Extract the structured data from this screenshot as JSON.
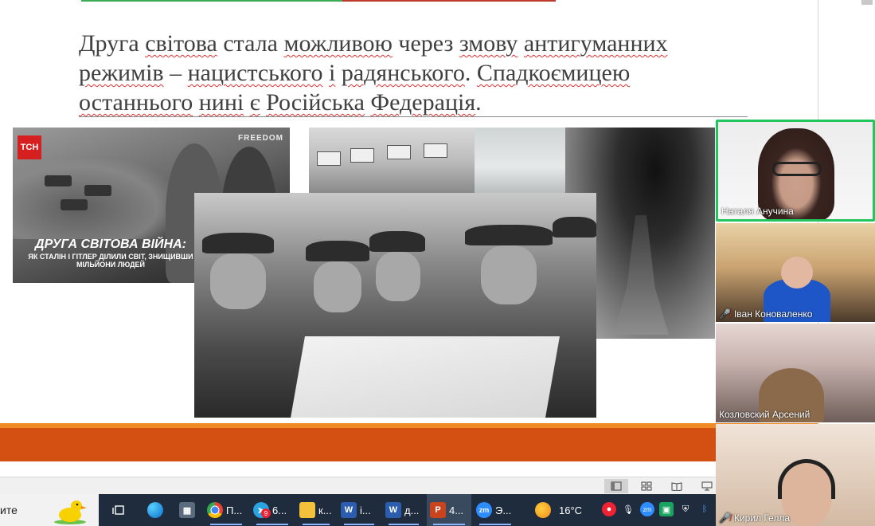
{
  "slide": {
    "text_parts": [
      {
        "t": "Друга ",
        "sq": false
      },
      {
        "t": "світова",
        "sq": true
      },
      {
        "t": " стала ",
        "sq": false
      },
      {
        "t": "можливою",
        "sq": true
      },
      {
        "t": " через ",
        "sq": false
      },
      {
        "t": "змову",
        "sq": true
      },
      {
        "t": " ",
        "sq": false
      },
      {
        "t": "антигуманних",
        "sq": true
      },
      {
        "t": " ",
        "sq": false
      },
      {
        "t": "режимів",
        "sq": true
      },
      {
        "t": " – ",
        "sq": false
      },
      {
        "t": "нацистського",
        "sq": true
      },
      {
        "t": " ",
        "sq": false
      },
      {
        "t": "і",
        "sq": true
      },
      {
        "t": " ",
        "sq": false
      },
      {
        "t": "радянського",
        "sq": true
      },
      {
        "t": ". ",
        "sq": false
      },
      {
        "t": "Спадкоємицею",
        "sq": true
      },
      {
        "t": " ",
        "sq": false
      },
      {
        "t": "останнього",
        "sq": true
      },
      {
        "t": " ",
        "sq": false
      },
      {
        "t": "нині",
        "sq": true
      },
      {
        "t": " ",
        "sq": false
      },
      {
        "t": "є",
        "sq": true
      },
      {
        "t": " ",
        "sq": false
      },
      {
        "t": "Російська",
        "sq": true
      },
      {
        "t": " ",
        "sq": false
      },
      {
        "t": "Федерація",
        "sq": true
      },
      {
        "t": ".",
        "sq": false
      }
    ],
    "tsn_logo": "ТСН",
    "freedom_logo": "FREEDOM",
    "tsn_headline": "ДРУГА СВІТОВА ВІЙНА:",
    "tsn_subline": "ЯК СТАЛІН І ГІТЛЕР ДІЛИЛИ СВІТ, ЗНИЩИВШИ МІЛЬЙОНИ ЛЮДЕЙ"
  },
  "participants": [
    {
      "name": "Наталя Анучина",
      "muted": false,
      "active": true
    },
    {
      "name": "Іван Коноваленко",
      "muted": true,
      "active": false
    },
    {
      "name": "Козловский Арсений",
      "muted": false,
      "active": false
    },
    {
      "name": "Кирил Гелла",
      "muted": true,
      "active": false
    }
  ],
  "taskbar": {
    "search_text": "ите",
    "items": [
      {
        "id": "chrome",
        "label": "П...",
        "color": "#e94235"
      },
      {
        "id": "telegram",
        "label": "6...",
        "color": "#2aa3e0",
        "badge": "9"
      },
      {
        "id": "explorer",
        "label": "к...",
        "color": "#f3c13a"
      },
      {
        "id": "word1",
        "label": "і...",
        "color": "#2b5cad"
      },
      {
        "id": "word2",
        "label": "д...",
        "color": "#2b5cad"
      },
      {
        "id": "powerpoint",
        "label": "4...",
        "color": "#c9441c"
      },
      {
        "id": "zoom",
        "label": "Э...",
        "color": "#2d8cff"
      }
    ],
    "weather_temp": "16°C"
  },
  "colors": {
    "accent_orange": "#d34f12",
    "accent_orange_light": "#f08a24",
    "active_speaker": "#22c55e",
    "taskbar_bg": "#1f2c3d"
  }
}
